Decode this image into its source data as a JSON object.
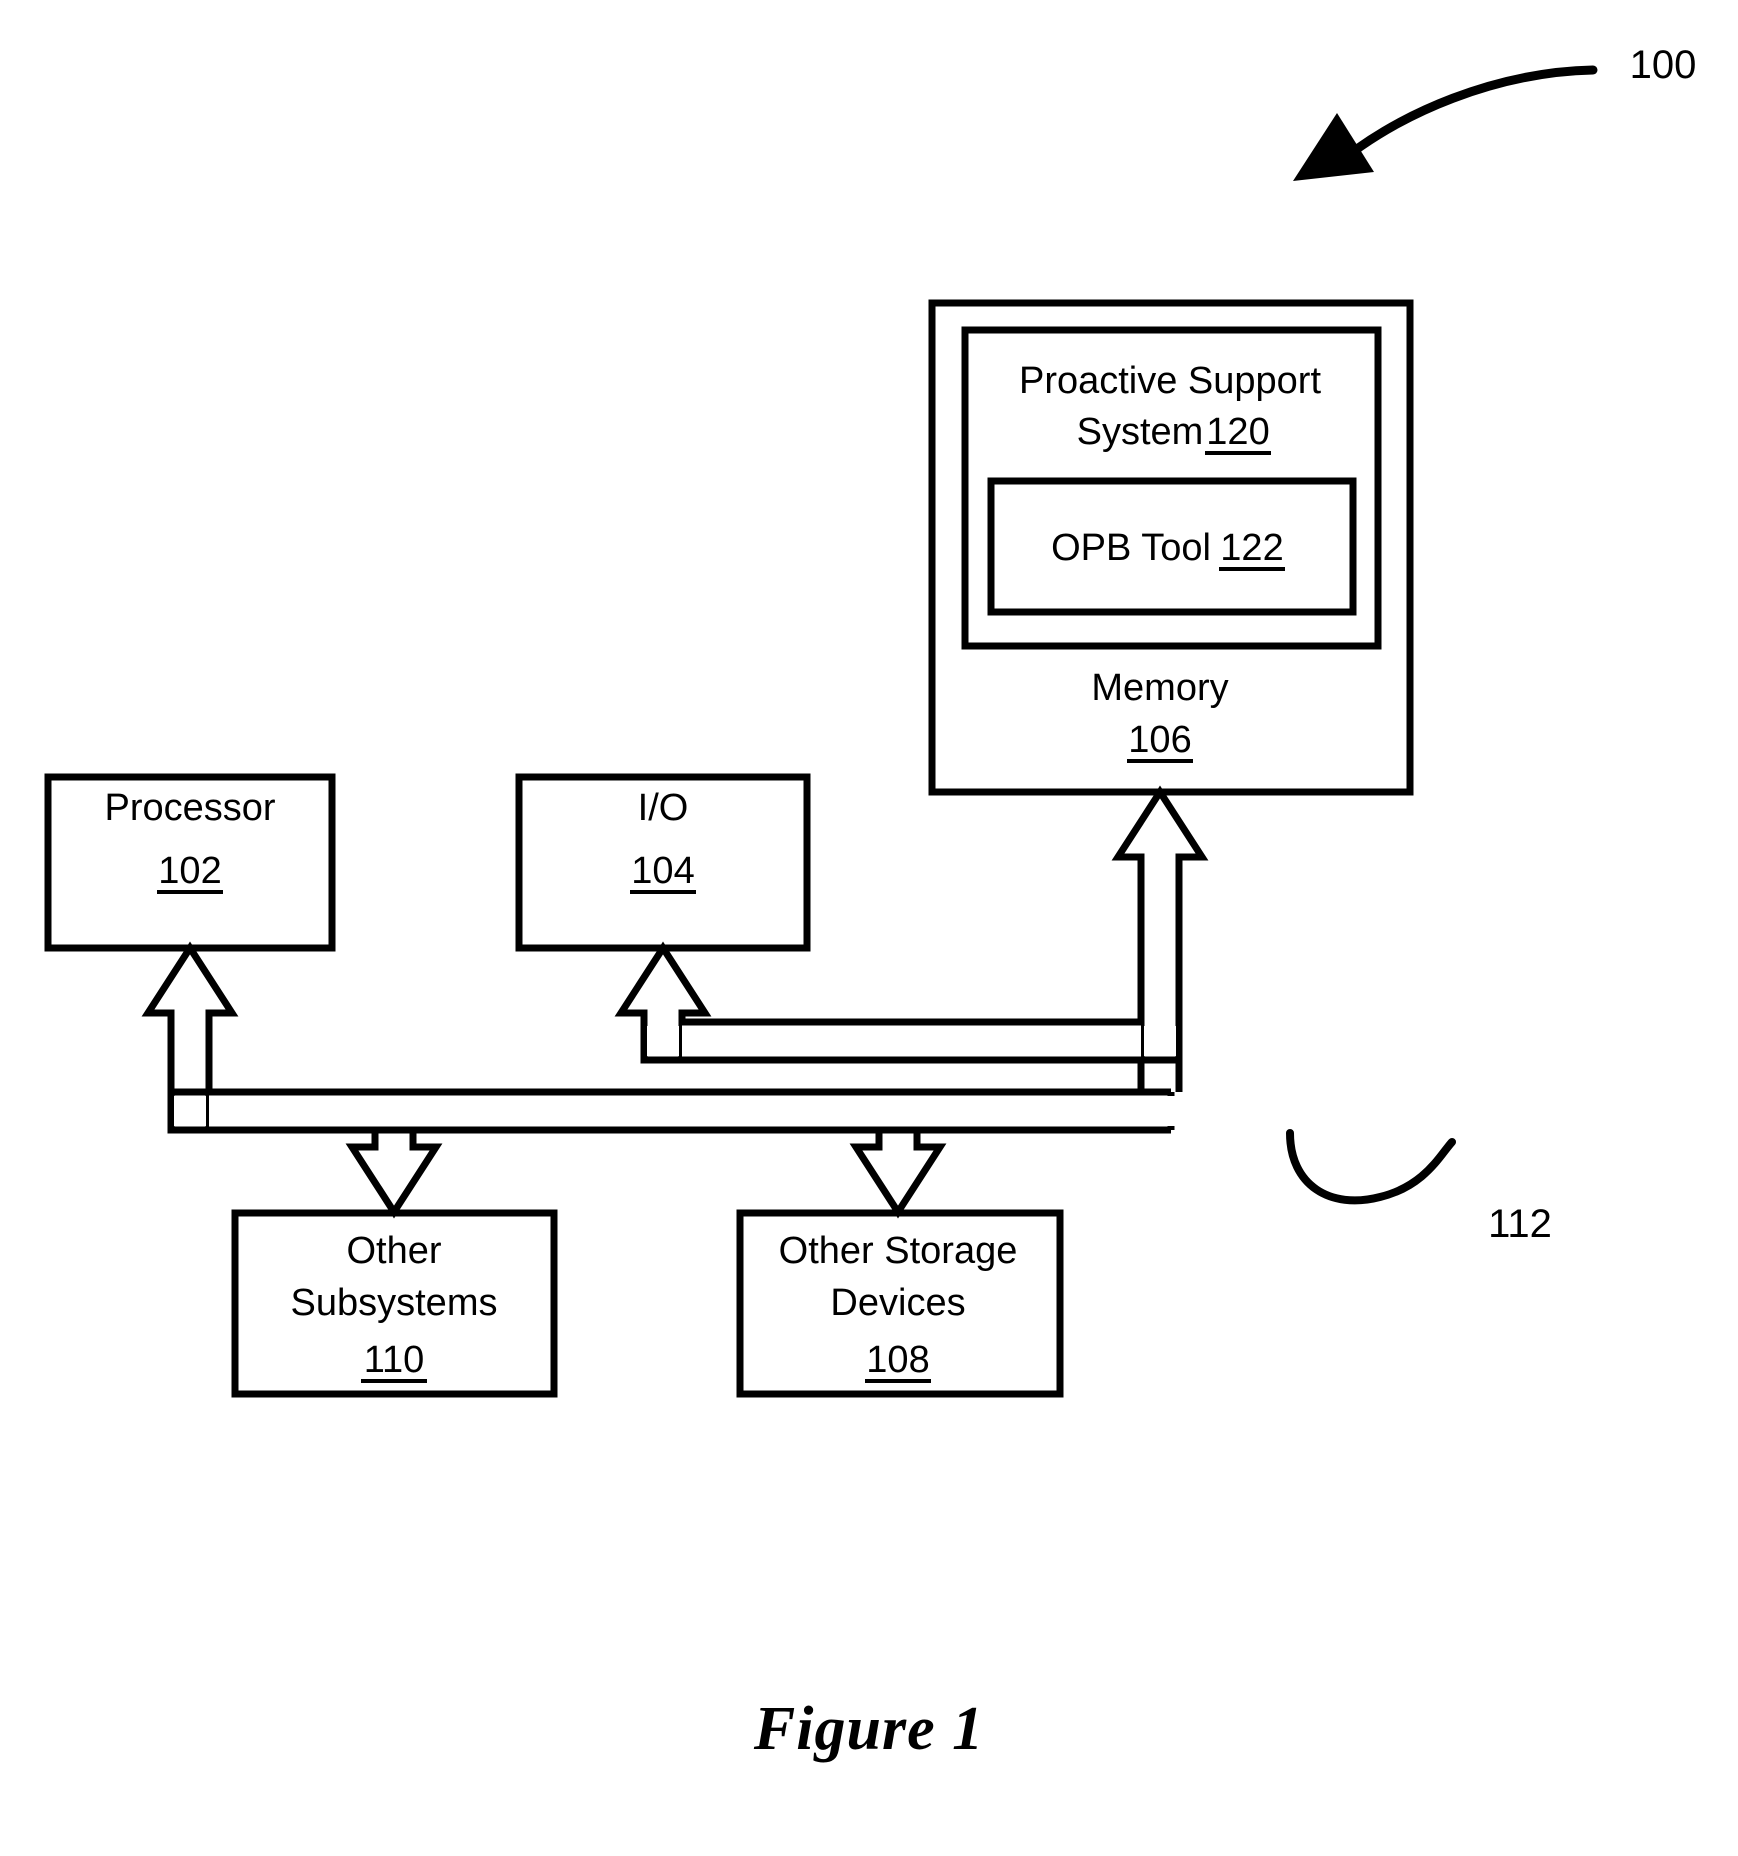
{
  "figure": {
    "caption": "Figure 1",
    "system_ref": "100",
    "bus_ref": "112"
  },
  "boxes": {
    "processor": {
      "label": "Processor",
      "ref": "102"
    },
    "io": {
      "label": "I/O",
      "ref": "104"
    },
    "memory": {
      "label": "Memory",
      "ref": "106"
    },
    "proactive_support_system": {
      "label_line1": "Proactive Support",
      "label_line2": "System",
      "ref": "120"
    },
    "opb_tool": {
      "label": "OPB Tool",
      "ref": "122"
    },
    "other_subsystems": {
      "label_line1": "Other",
      "label_line2": "Subsystems",
      "ref": "110"
    },
    "other_storage_devices": {
      "label_line1": "Other Storage",
      "label_line2": "Devices",
      "ref": "108"
    }
  },
  "colors": {
    "stroke": "#000000",
    "background": "#ffffff"
  }
}
